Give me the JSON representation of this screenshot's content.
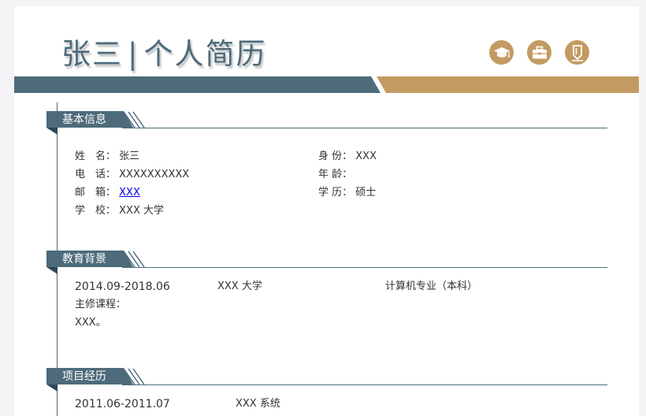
{
  "header": {
    "name": "张三",
    "separator": "|",
    "title": "个人简历",
    "icons": [
      "graduation-cap-icon",
      "briefcase-icon",
      "pencil-icon"
    ]
  },
  "basic": {
    "heading": "基本信息",
    "name_label": "姓　名：",
    "name_value": "张三",
    "phone_label": "电　话：",
    "phone_value": "XXXXXXXXXX",
    "email_label": "邮　箱：",
    "email_value": "XXX",
    "school_label": "学　校：",
    "school_value": "XXX 大学",
    "id_label": "身 份：",
    "id_value": "XXX",
    "age_label": "年 龄：",
    "age_value": "",
    "degree_label": "学 历：",
    "degree_value": "硕士"
  },
  "education": {
    "heading": "教育背景",
    "period": "2014.09-2018.06",
    "school": "XXX 大学",
    "major": "计算机专业（本科）",
    "courses_label": "主修课程：",
    "courses_value": "XXX。"
  },
  "projects": {
    "heading": "项目经历",
    "period": "2011.06-2011.07",
    "company": "XXX 系统"
  },
  "colors": {
    "primary": "#4d6b7b",
    "accent": "#c39b62",
    "background": "#f4f4f6"
  }
}
